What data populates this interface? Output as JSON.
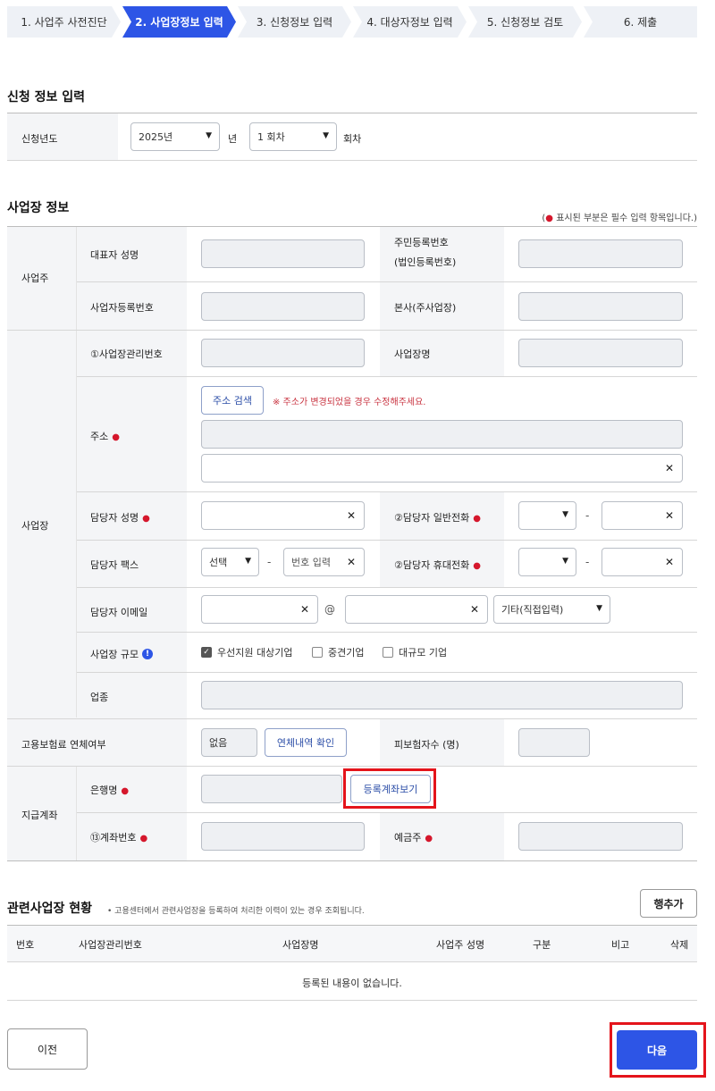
{
  "stepper": [
    "1. 사업주 사전진단",
    "2. 사업장정보 입력",
    "3. 신청정보 입력",
    "4. 대상자정보 입력",
    "5. 신청정보 검토",
    "6. 제출"
  ],
  "apply_section": {
    "title": "신청 정보 입력",
    "year_label": "신청년도",
    "year_value": "2025년",
    "year_unit": "년",
    "round_value": "1 회차",
    "round_unit": "회차"
  },
  "biz_section": {
    "title": "사업장 정보",
    "required_note": "표시된 부분은 필수 입력 항목입니다.",
    "required_note_open": "(",
    "required_note_close": ")",
    "owner_group": "사업주",
    "rep_name": "대표자 성명",
    "resident_no": "주민등록번호",
    "corp_no": "(법인등록번호)",
    "biz_reg_no": "사업자등록번호",
    "hq": "본사(주사업장)",
    "site_group": "사업장",
    "site_mgmt_no": "①사업장관리번호",
    "site_name": "사업장명",
    "address": "주소",
    "address_search": "주소 검색",
    "address_warning": "※ 주소가 변경되었을 경우 수정해주세요.",
    "manager_name": "담당자 성명",
    "manager_phone": "②담당자 일반전화",
    "manager_fax": "담당자 팩스",
    "fax_select": "선택",
    "fax_placeholder": "번호 입력",
    "manager_mobile": "②담당자 휴대전화",
    "manager_email": "담당자 이메일",
    "email_at": "@",
    "email_domain": "기타(직접입력)",
    "site_scale": "사업장 규모",
    "scale_options": [
      "우선지원 대상기업",
      "중견기업",
      "대규모 기업"
    ],
    "industry": "업종",
    "insurance_arrears": "고용보험료 연체여부",
    "arrears_value": "없음",
    "arrears_check": "연체내역 확인",
    "insured_count": "피보험자수 (명)",
    "account_group": "지급계좌",
    "bank_name": "은행명",
    "view_account": "등록계좌보기",
    "account_no": "⑬계좌번호",
    "depositor": "예금주"
  },
  "related": {
    "title": "관련사업장 현황",
    "note": "• 고용센터에서 관련사업장을 등록하여 처리한 이력이 있는 경우 조회됩니다.",
    "add_row": "행추가",
    "columns": [
      "번호",
      "사업장관리번호",
      "사업장명",
      "사업주 성명",
      "구분",
      "비고",
      "삭제"
    ],
    "empty": "등록된 내용이 없습니다."
  },
  "footer": {
    "prev": "이전",
    "next": "다음"
  },
  "colors": {
    "accent": "#2d55e6",
    "required": "#d5172c",
    "highlight": "#e4141b"
  }
}
